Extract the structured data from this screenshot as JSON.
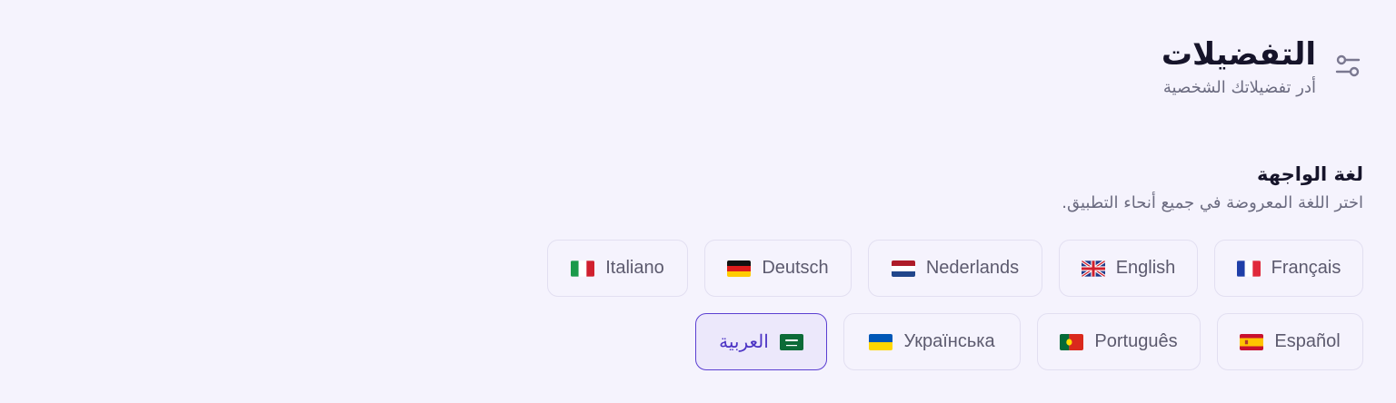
{
  "header": {
    "title": "التفضيلات",
    "subtitle": "أدر تفضيلاتك الشخصية",
    "icon": "sliders-icon"
  },
  "language_section": {
    "title": "لغة الواجهة",
    "description": "اختر اللغة المعروضة في جميع أنحاء التطبيق.",
    "selected": "العربية",
    "rows": [
      [
        {
          "label": "Français",
          "flag": "flag-fr-icon"
        },
        {
          "label": "English",
          "flag": "flag-gb-icon"
        },
        {
          "label": "Nederlands",
          "flag": "flag-nl-icon"
        },
        {
          "label": "Deutsch",
          "flag": "flag-de-icon"
        },
        {
          "label": "Italiano",
          "flag": "flag-it-icon"
        }
      ],
      [
        {
          "label": "Español",
          "flag": "flag-es-icon"
        },
        {
          "label": "Português",
          "flag": "flag-pt-icon"
        },
        {
          "label": "Українська",
          "flag": "flag-ua-icon"
        },
        {
          "label": "العربية",
          "flag": "flag-sa-icon"
        }
      ]
    ]
  },
  "colors": {
    "accent": "#5b3fd1",
    "background": "#f5f3fd",
    "border": "#e2dff1"
  }
}
